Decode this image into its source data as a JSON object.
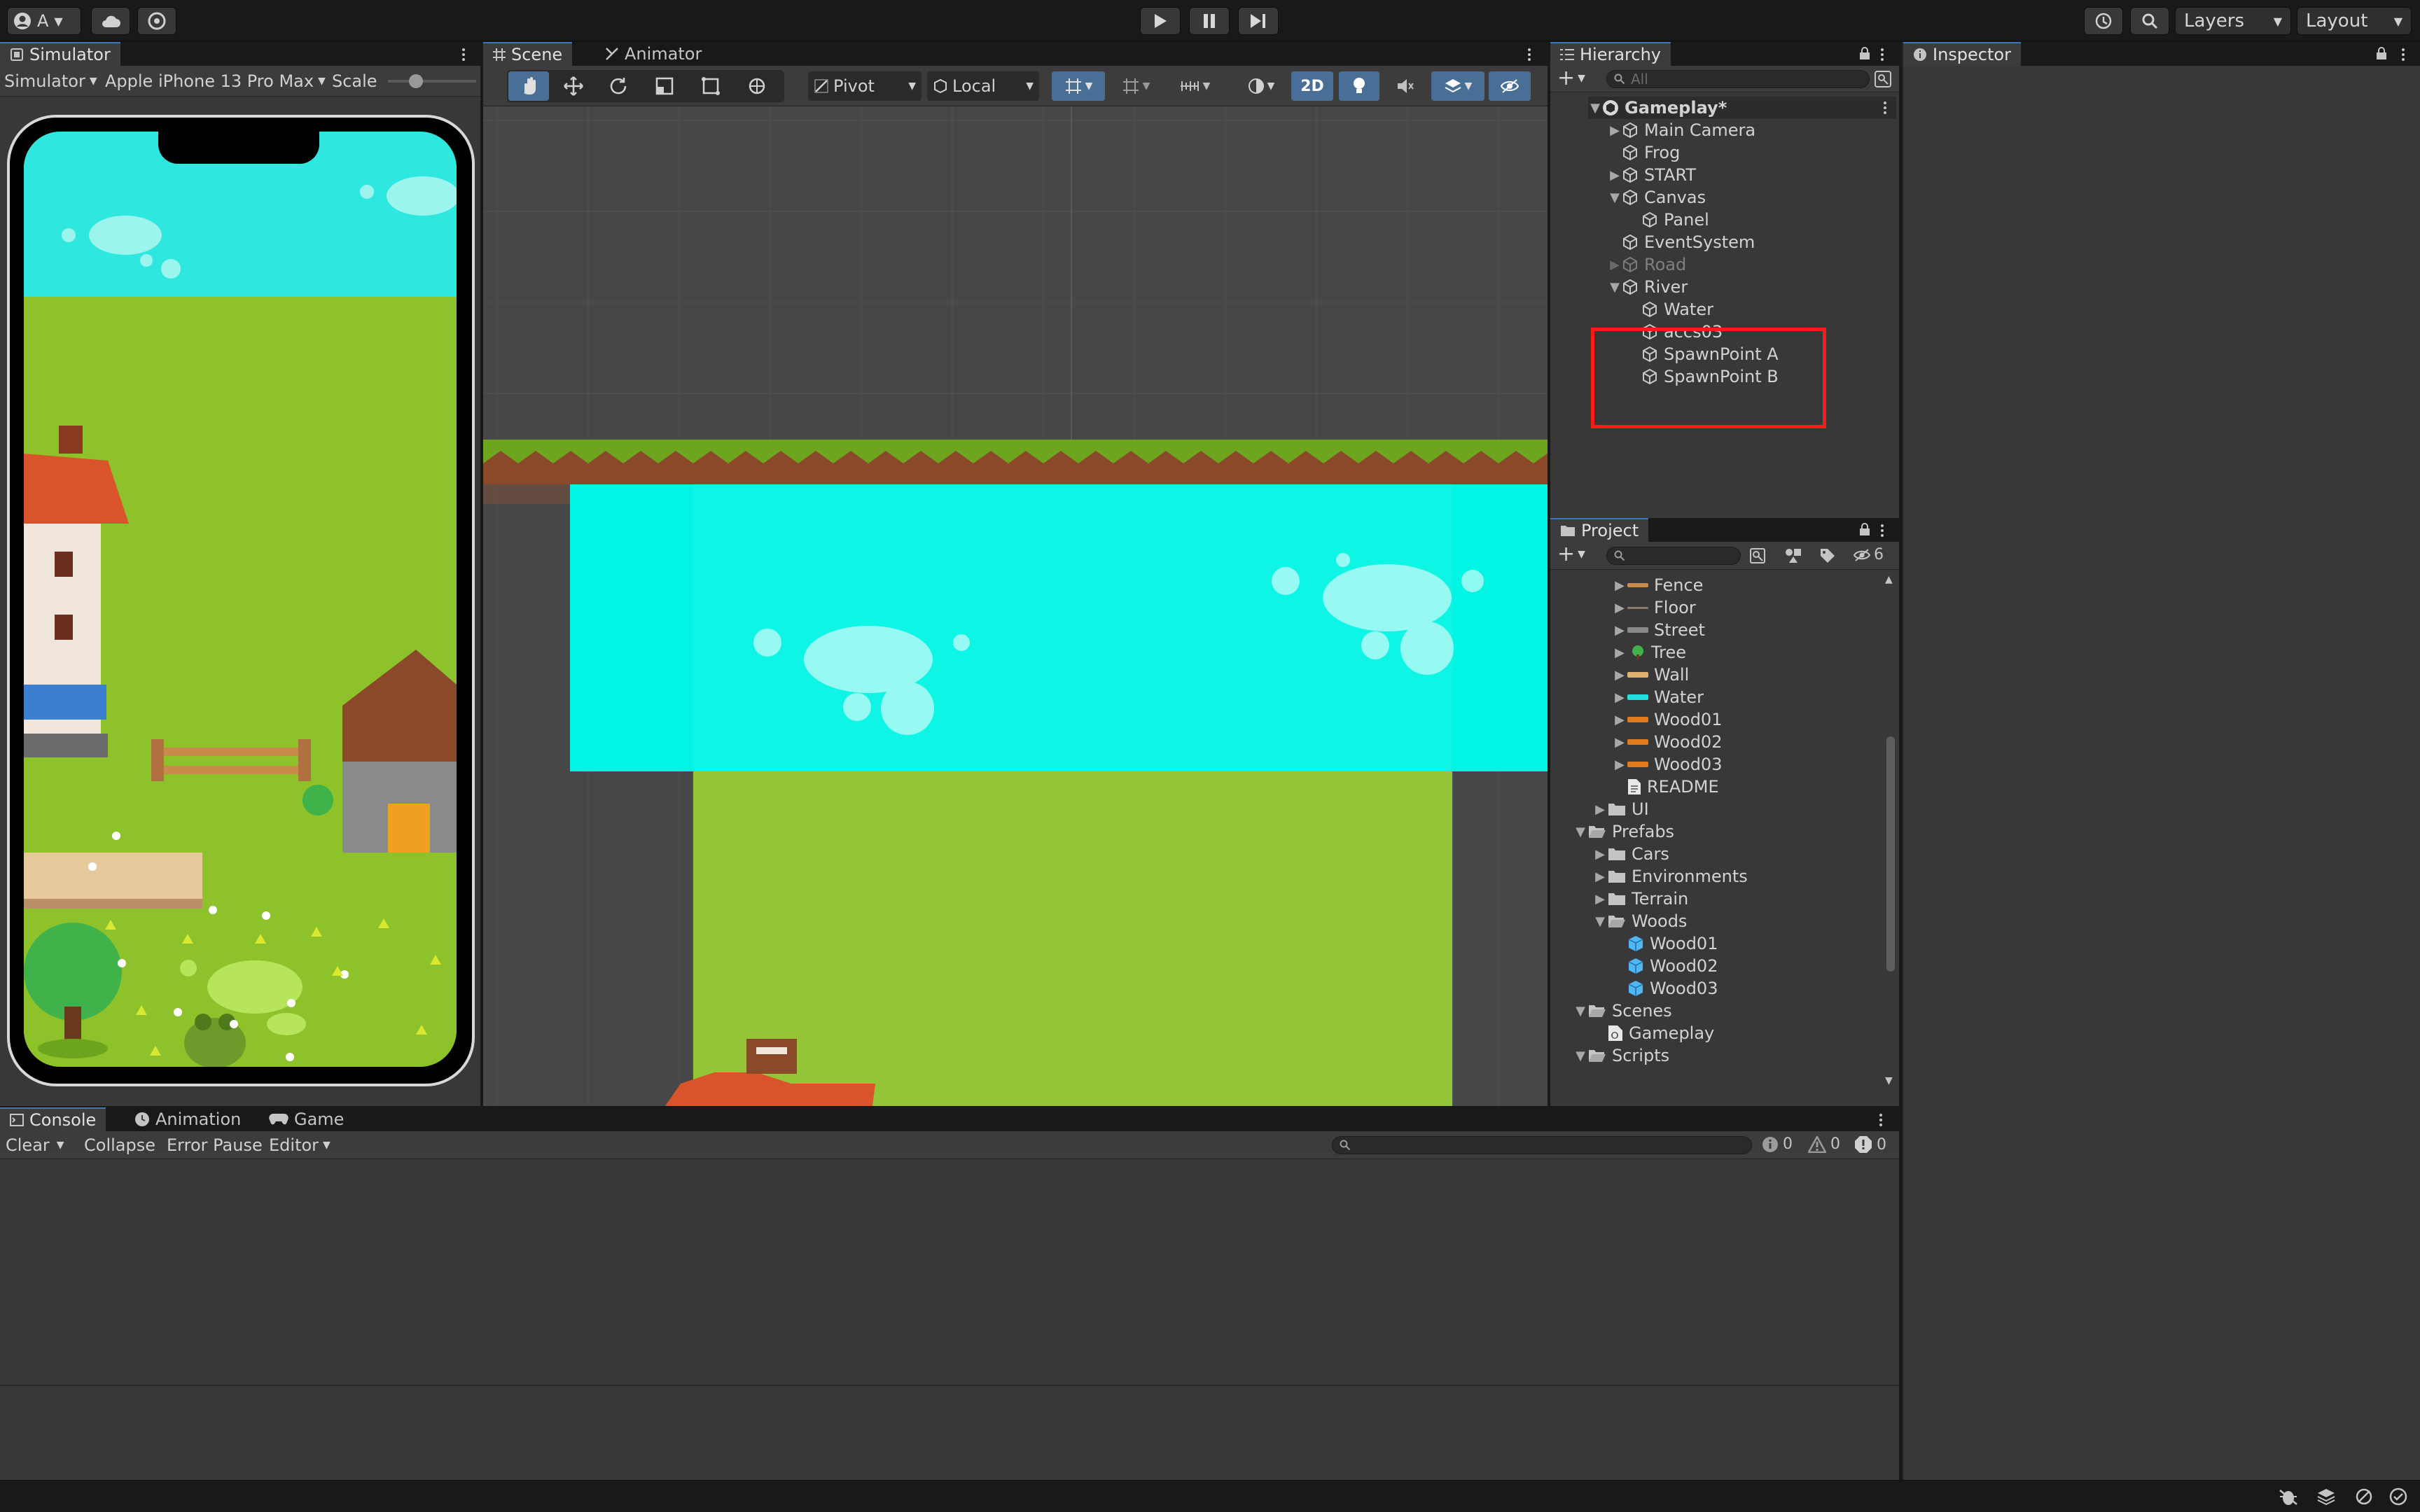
{
  "toolbar": {
    "account_label": "A",
    "layers_label": "Layers",
    "layout_label": "Layout"
  },
  "simulator": {
    "tab": "Simulator",
    "mode": "Simulator",
    "device": "Apple iPhone 13 Pro Max",
    "scale_label": "Scale"
  },
  "scene": {
    "tabs": [
      "Scene",
      "Animator"
    ],
    "pivot_label": "Pivot",
    "local_label": "Local",
    "mode_2d": "2D"
  },
  "hierarchy": {
    "tab": "Hierarchy",
    "search_placeholder": "All",
    "scene_name": "Gameplay*",
    "items": [
      {
        "label": "Main Camera"
      },
      {
        "label": "Frog"
      },
      {
        "label": "START"
      },
      {
        "label": "Canvas"
      },
      {
        "label": "Panel"
      },
      {
        "label": "EventSystem"
      },
      {
        "label": "Road"
      },
      {
        "label": "River"
      },
      {
        "label": "Water"
      },
      {
        "label": "accs03"
      },
      {
        "label": "SpawnPoint A"
      },
      {
        "label": "SpawnPoint B"
      }
    ]
  },
  "inspector": {
    "tab": "Inspector"
  },
  "project": {
    "tab": "Project",
    "hidden_count": "6",
    "items": [
      {
        "label": "Fence",
        "color": "#c98a4a"
      },
      {
        "label": "Floor",
        "color": "#8a7a6a"
      },
      {
        "label": "Street",
        "color": "#888888"
      },
      {
        "label": "Tree",
        "color": "#3fb24a"
      },
      {
        "label": "Wall",
        "color": "#e0b070"
      },
      {
        "label": "Water",
        "color": "#22e0e0"
      },
      {
        "label": "Wood01",
        "color": "#e07a1a"
      },
      {
        "label": "Wood02",
        "color": "#e07a1a"
      },
      {
        "label": "Wood03",
        "color": "#e07a1a"
      },
      {
        "label": "README"
      },
      {
        "label": "UI"
      },
      {
        "label": "Prefabs"
      },
      {
        "label": "Cars"
      },
      {
        "label": "Environments"
      },
      {
        "label": "Terrain"
      },
      {
        "label": "Woods"
      },
      {
        "label": "Wood01"
      },
      {
        "label": "Wood02"
      },
      {
        "label": "Wood03"
      },
      {
        "label": "Scenes"
      },
      {
        "label": "Gameplay"
      },
      {
        "label": "Scripts"
      }
    ]
  },
  "console": {
    "tabs": [
      "Console",
      "Animation",
      "Game"
    ],
    "clear_label": "Clear",
    "collapse_label": "Collapse",
    "error_pause_label": "Error Pause",
    "editor_label": "Editor",
    "log_count": "0",
    "warning_count": "0",
    "error_count": "0"
  },
  "colors": {
    "water": "#00f5e4",
    "grass": "#8dc22b",
    "sky": "#2ee8df",
    "highlight": "#ff1a1a"
  }
}
